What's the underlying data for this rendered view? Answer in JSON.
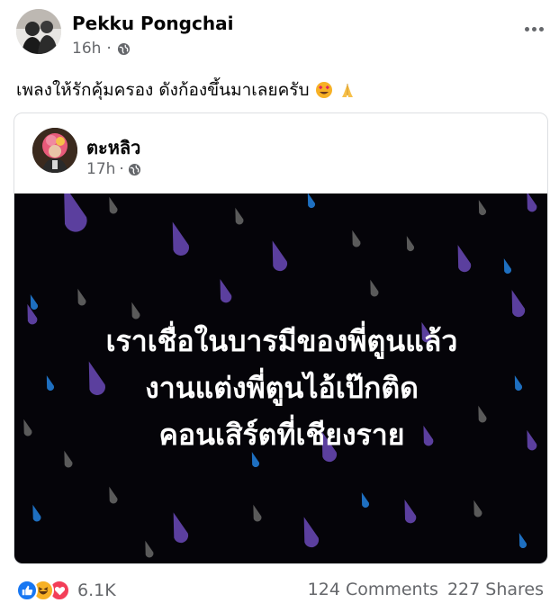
{
  "post": {
    "author": "Pekku Pongchai",
    "time": "16h",
    "audience_icon": "globe-icon",
    "text": "เพลงให้รักคุ้มครอง ดังก้องขึ้นมาเลยครับ",
    "emojis": [
      "heart-eyes-emoji",
      "folded-hands-emoji"
    ]
  },
  "shared_post": {
    "author": "ตะหลิว",
    "time": "17h",
    "audience_icon": "globe-icon",
    "image_text_lines": [
      "เราเชื่อในบารมีของพี่ตูนแล้ว",
      "งานแต่งพี่ตูนไอ้เป๊กติด",
      "คอนเสิร์ตที่เชียงราย"
    ],
    "image_background": "#050409"
  },
  "footer": {
    "reaction_icons": [
      "like-icon",
      "haha-icon",
      "love-icon"
    ],
    "reaction_count": "6.1K",
    "comments": "124 Comments",
    "shares": "227 Shares"
  },
  "colors": {
    "like": "#1877f2",
    "love": "#f33e58",
    "haha": "#f7b125",
    "muted": "#65676b",
    "drop_purple": "#5b3f9e",
    "drop_blue": "#1e6fc0",
    "drop_gray": "#5a5a5a"
  }
}
